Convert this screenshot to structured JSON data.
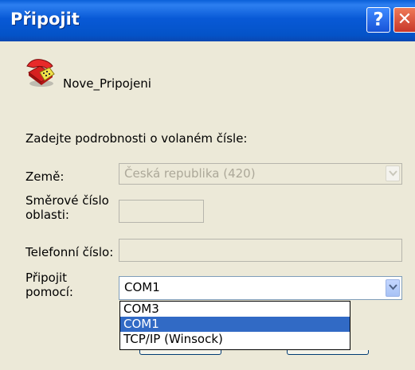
{
  "window": {
    "title": "Připojit",
    "help_glyph": "?",
    "close_glyph": "✕"
  },
  "connection": {
    "name": "Nove_Pripojeni",
    "icon": "phone-icon"
  },
  "form": {
    "intro": "Zadejte podrobnosti o volaném čísle:",
    "country_label": "Země:",
    "country_value": "Česká republika (420)",
    "area_label_line1": "Směrové číslo",
    "area_label_line2": "oblasti:",
    "area_value": "",
    "phone_label": "Telefonní číslo:",
    "phone_value": "",
    "connect_label_line1": "Připojit",
    "connect_label_line2": "pomocí:",
    "connect_value": "COM1"
  },
  "dropdown_options": [
    {
      "label": "COM3",
      "selected": false
    },
    {
      "label": "COM1",
      "selected": true
    },
    {
      "label": "TCP/IP (Winsock)",
      "selected": false
    }
  ],
  "colors": {
    "titlebar": "#0453c8",
    "selection": "#316ac5",
    "face": "#ece9d8"
  }
}
